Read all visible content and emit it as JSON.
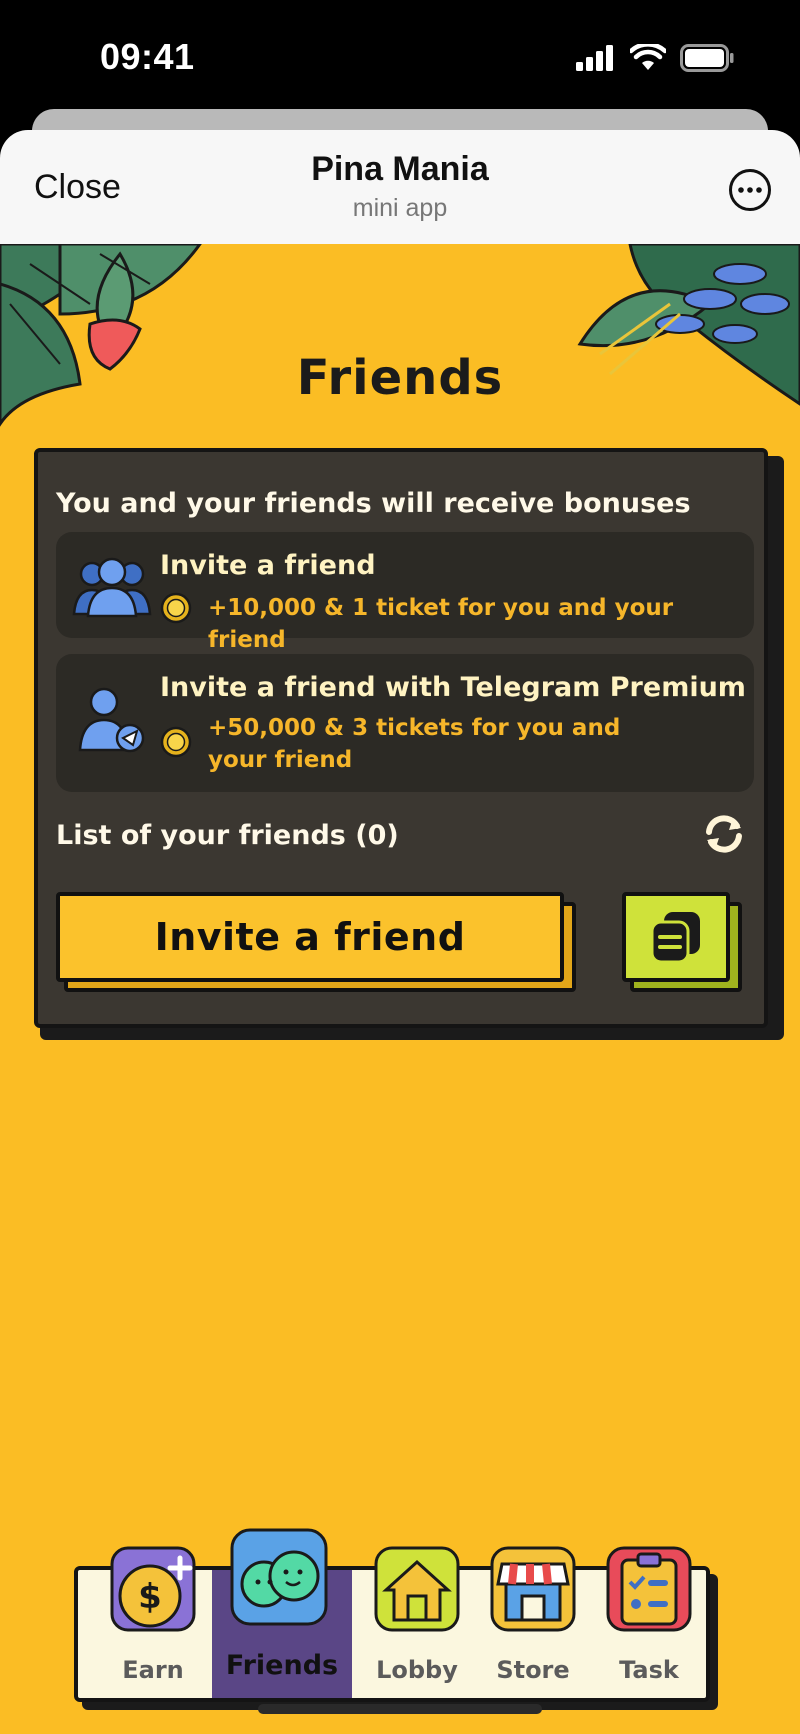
{
  "status_bar": {
    "time": "09:41"
  },
  "telegram_header": {
    "close_label": "Close",
    "title": "Pina Mania",
    "subtitle": "mini app"
  },
  "page": {
    "title": "Friends"
  },
  "card": {
    "intro": "You and your friends will receive bonuses",
    "bonuses": [
      {
        "title": "Invite a friend",
        "reward": "+10,000 & 1 ticket for you and your friend",
        "icon": "users-icon"
      },
      {
        "title": "Invite a friend with Telegram Premium",
        "reward": "+50,000 & 3 tickets for you and your friend",
        "icon": "premium-user-icon"
      }
    ],
    "friends_list_label": "List of your friends (0)",
    "invite_button_label": "Invite a friend"
  },
  "nav": {
    "items": [
      {
        "label": "Earn",
        "icon": "earn-coin-icon"
      },
      {
        "label": "Friends",
        "icon": "friends-icon",
        "active": true
      },
      {
        "label": "Lobby",
        "icon": "house-icon"
      },
      {
        "label": "Store",
        "icon": "store-icon"
      },
      {
        "label": "Task",
        "icon": "task-icon"
      }
    ]
  },
  "colors": {
    "background": "#fbbd24",
    "card": "#3b3731",
    "accent": "#f6b62a",
    "nav_active": "#5a4686"
  }
}
